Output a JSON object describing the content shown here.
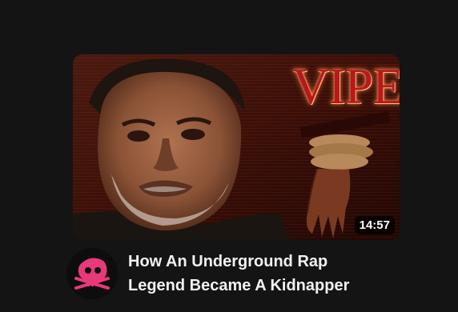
{
  "video": {
    "thumbnail_text": "VIPER",
    "duration": "14:57",
    "title_line1": "How An Underground Rap",
    "title_line2": "Legend Became A Kidnapper"
  },
  "channel": {
    "avatar_icon": "pink-skull-icon",
    "avatar_color": "#e8397a"
  },
  "colors": {
    "background": "#141414",
    "title_text": "#f1f1f1",
    "thumbnail_title": "#b8181c"
  }
}
